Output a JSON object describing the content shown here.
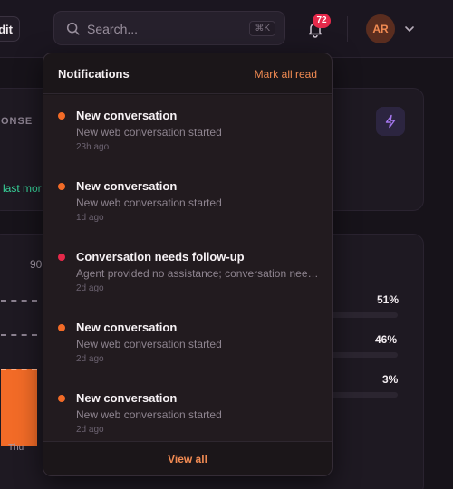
{
  "topbar": {
    "edit_label": "dit",
    "search_placeholder": "Search...",
    "search_shortcut": "⌘K",
    "notification_count": "72",
    "avatar_initials": "AR"
  },
  "background": {
    "card1_label": "ONSE",
    "card1_trend": "last mor",
    "card2_axis_value": "90",
    "card2_day": "Thu",
    "percentages": [
      "51%",
      "46%",
      "3%"
    ]
  },
  "notifications": {
    "title": "Notifications",
    "mark_all_read": "Mark all read",
    "items": [
      {
        "title": "New conversation",
        "body": "New web conversation started",
        "time": "23h ago",
        "dot_color": "#f26b27"
      },
      {
        "title": "New conversation",
        "body": "New web conversation started",
        "time": "1d ago",
        "dot_color": "#f26b27"
      },
      {
        "title": "Conversation needs follow-up",
        "body": "Agent provided no assistance; conversation needs follow-up",
        "time": "2d ago",
        "dot_color": "#e5294a"
      },
      {
        "title": "New conversation",
        "body": "New web conversation started",
        "time": "2d ago",
        "dot_color": "#f26b27"
      },
      {
        "title": "New conversation",
        "body": "New web conversation started",
        "time": "2d ago",
        "dot_color": "#f26b27"
      }
    ],
    "view_all": "View all"
  },
  "colors": {
    "accent": "#f08a52",
    "badge": "#e5294a",
    "trend_positive": "#37d39a"
  }
}
